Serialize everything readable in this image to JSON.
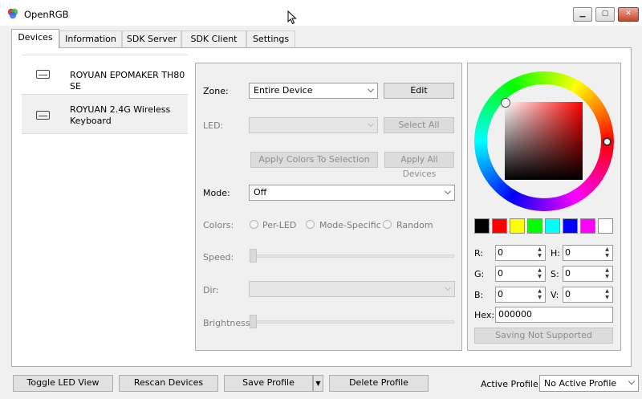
{
  "window": {
    "title": "OpenRGB"
  },
  "tabs": [
    "Devices",
    "Information",
    "SDK Server",
    "SDK Client",
    "Settings"
  ],
  "devices": [
    {
      "label_lines": [
        "ROYUAN EPOMAKER TH80 SE"
      ],
      "icon": "keyboard-icon",
      "selected": true
    },
    {
      "label_lines": [
        "ROYUAN 2.4G Wireless",
        "Keyboard"
      ],
      "icon": "keyboard-icon",
      "selected": false
    }
  ],
  "controls": {
    "zone_label": "Zone:",
    "zone_value": "Entire Device",
    "edit_button": "Edit",
    "led_label": "LED:",
    "led_value": "",
    "select_all_button": "Select All",
    "apply_colors_selection_button": "Apply Colors To Selection",
    "apply_all_devices_button": "Apply All Devices",
    "mode_label": "Mode:",
    "mode_value": "Off",
    "colors_label": "Colors:",
    "color_modes": [
      "Per-LED",
      "Mode-Specific",
      "Random"
    ],
    "speed_label": "Speed:",
    "dir_label": "Dir:",
    "dir_value": "",
    "brightness_label": "Brightness:"
  },
  "color_picker": {
    "swatches": [
      "#000000",
      "#ff0000",
      "#ffff00",
      "#00ff00",
      "#00ffff",
      "#0000ff",
      "#ff00ff",
      "#ffffff"
    ],
    "r_label": "R:",
    "r_value": "0",
    "g_label": "G:",
    "g_value": "0",
    "b_label": "B:",
    "b_value": "0",
    "h_label": "H:",
    "h_value": "0",
    "s_label": "S:",
    "s_value": "0",
    "v_label": "V:",
    "v_value": "0",
    "hex_label": "Hex:",
    "hex_value": "000000",
    "saving_button": "Saving Not Supported"
  },
  "bottom_bar": {
    "toggle_led_view": "Toggle LED View",
    "rescan_devices": "Rescan Devices",
    "save_profile": "Save Profile",
    "delete_profile": "Delete Profile",
    "active_profile_label": "Active Profile:",
    "active_profile_value": "No Active Profile"
  }
}
